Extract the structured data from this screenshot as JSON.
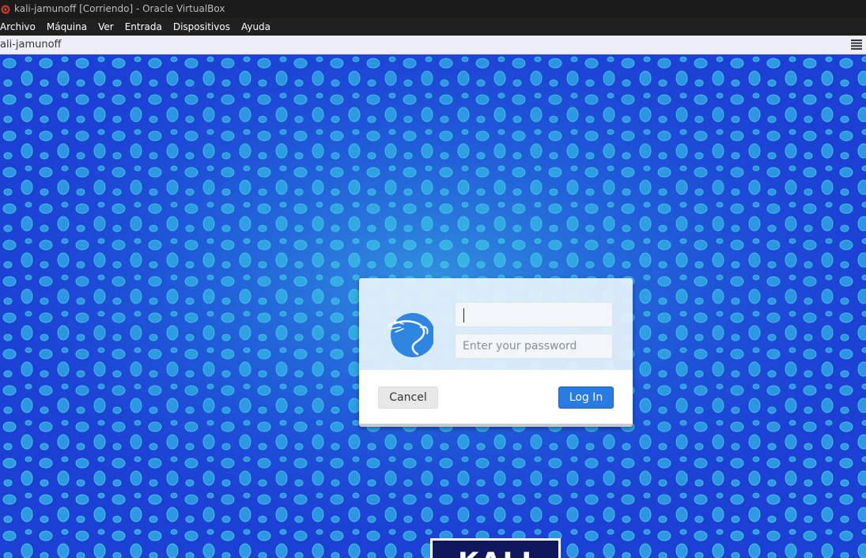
{
  "window": {
    "title": "kali-jamunoff [Corriendo] - Oracle VirtualBox",
    "app_icon": "virtualbox-icon"
  },
  "menubar": {
    "items": [
      {
        "label": "Archivo"
      },
      {
        "label": "Máquina"
      },
      {
        "label": "Ver"
      },
      {
        "label": "Entrada"
      },
      {
        "label": "Dispositivos"
      },
      {
        "label": "Ayuda"
      }
    ]
  },
  "vmbar": {
    "name": "ali-jamunoff",
    "menu_icon": "hamburger-icon"
  },
  "login": {
    "avatar_icon": "kali-dragon-icon",
    "username_value": "",
    "password_placeholder": "Enter your password",
    "cancel_label": "Cancel",
    "login_label": "Log In"
  },
  "desktop": {
    "logo_text": "KALI"
  },
  "colors": {
    "accent": "#2a7ae4",
    "desktop_blue": "#1f3fd8",
    "desktop_cyan": "#34b7e6"
  }
}
